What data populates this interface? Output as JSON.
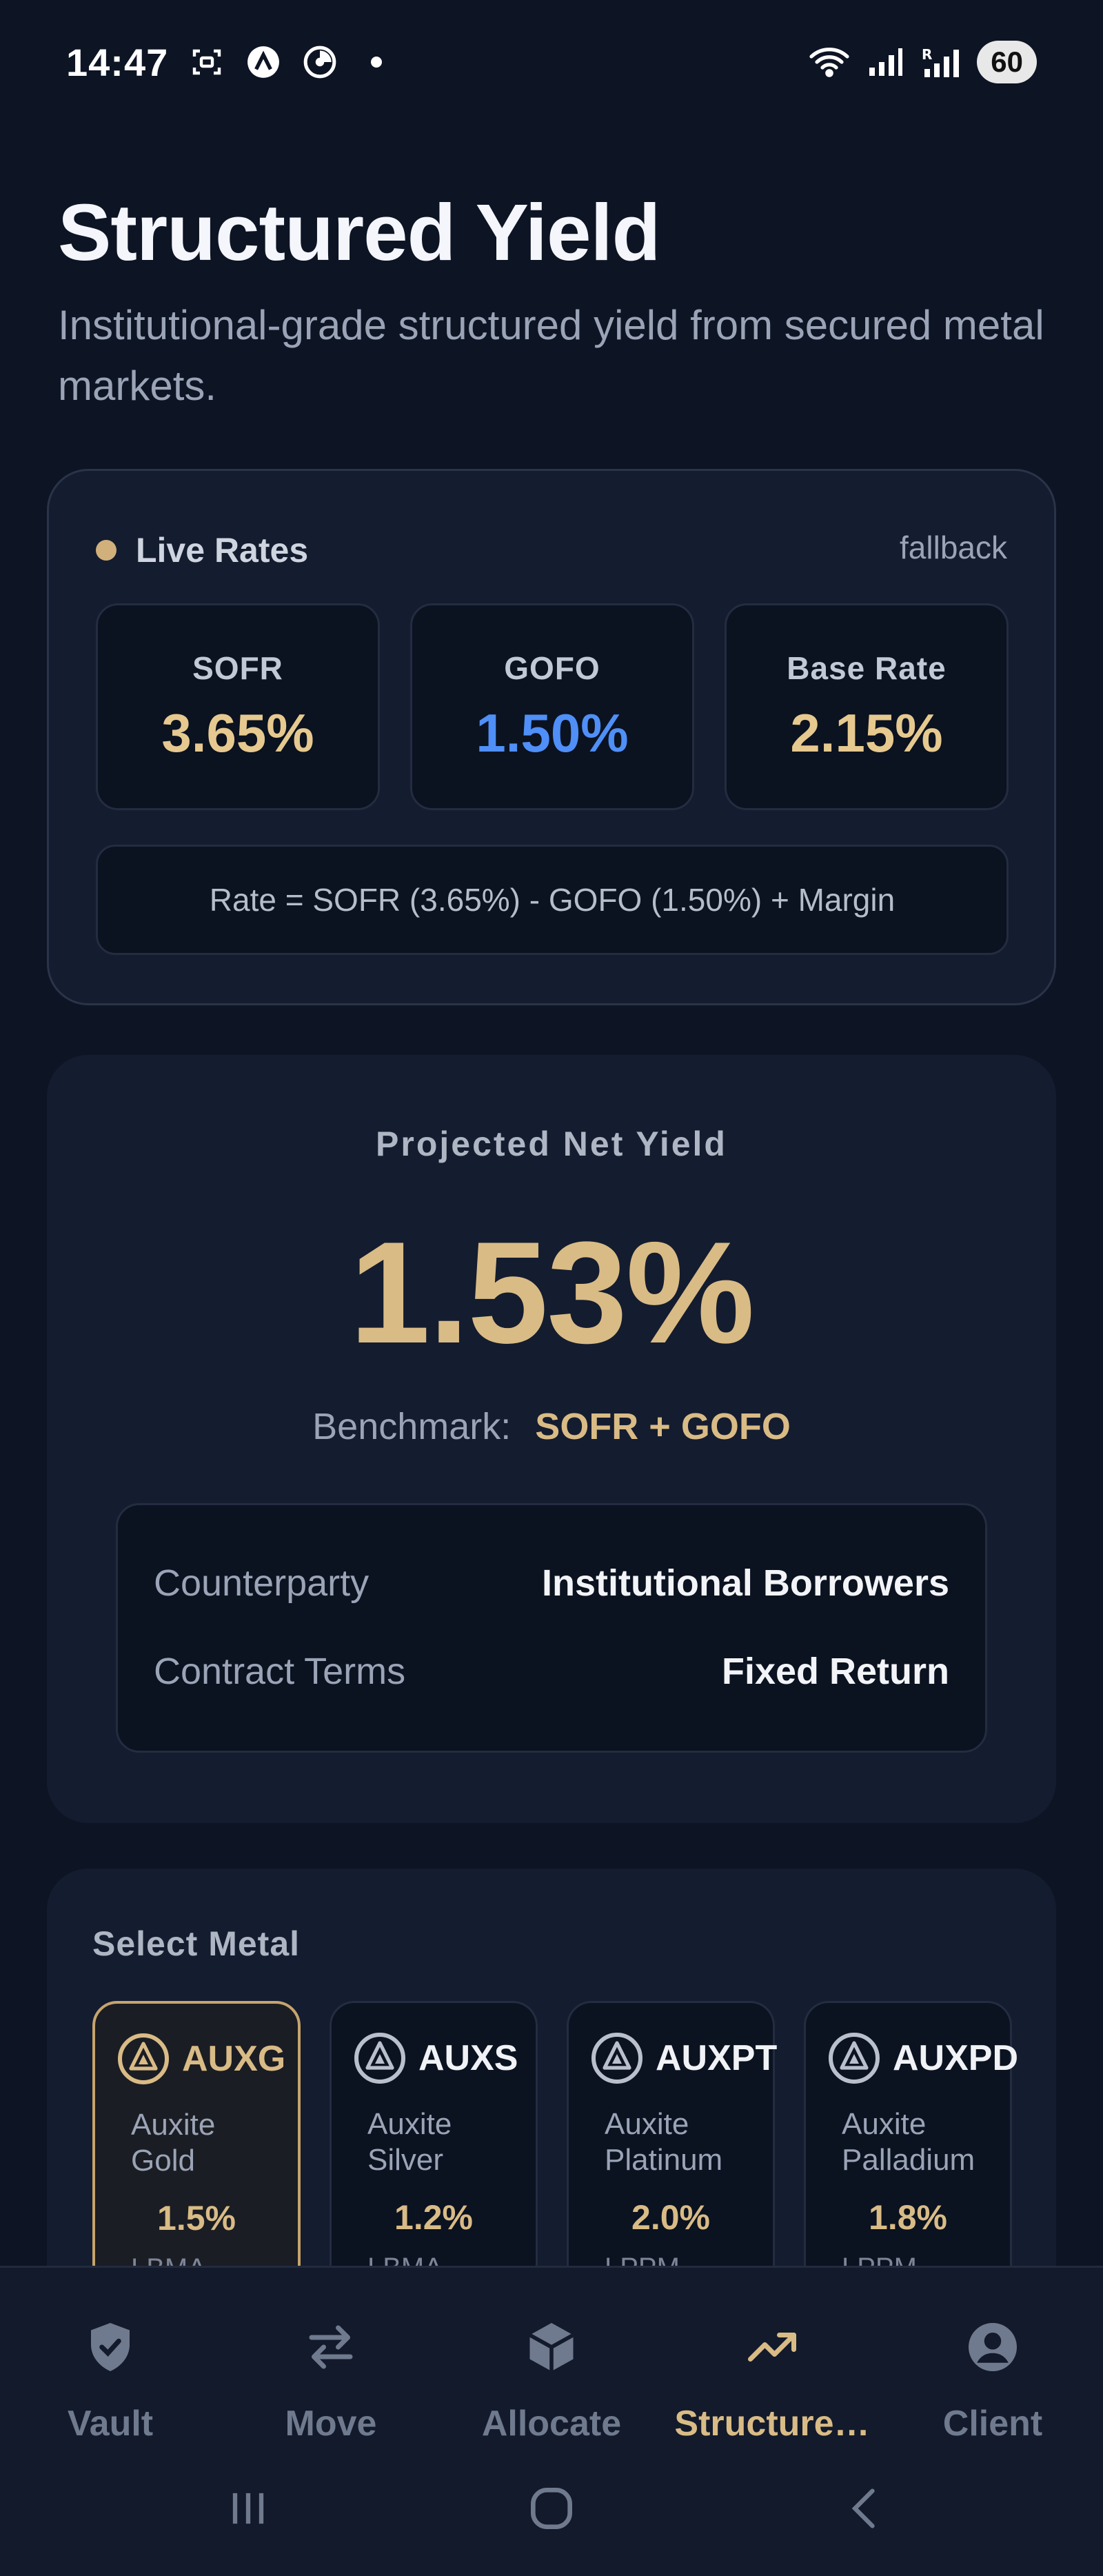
{
  "status_bar": {
    "time": "14:47",
    "battery": "60"
  },
  "header": {
    "title": "Structured Yield",
    "subtitle": "Institutional-grade structured yield from secured metal markets."
  },
  "live_rates": {
    "title": "Live Rates",
    "status": "fallback",
    "dot_color": "#d1b07c",
    "rates": [
      {
        "label": "SOFR",
        "value": "3.65%",
        "color": "#e6c98f"
      },
      {
        "label": "GOFO",
        "value": "1.50%",
        "color": "#4f8ff7"
      },
      {
        "label": "Base Rate",
        "value": "2.15%",
        "color": "#e6c98f"
      }
    ],
    "formula": "Rate = SOFR (3.65%) - GOFO (1.50%) + Margin"
  },
  "projected_yield": {
    "label": "Projected Net Yield",
    "value": "1.53%",
    "benchmark_label": "Benchmark:",
    "benchmark_value": "SOFR + GOFO",
    "details": [
      {
        "key": "Counterparty",
        "value": "Institutional Borrowers"
      },
      {
        "key": "Contract Terms",
        "value": "Fixed Return"
      }
    ]
  },
  "select_metal": {
    "title": "Select Metal",
    "metals": [
      {
        "symbol": "AUXG",
        "name": "Auxite Gold",
        "rate": "1.5%",
        "market": "LBMA",
        "selected": true
      },
      {
        "symbol": "AUXS",
        "name": "Auxite Silver",
        "rate": "1.2%",
        "market": "LBMA",
        "selected": false
      },
      {
        "symbol": "AUXPT",
        "name": "Auxite Platinum",
        "rate": "2.0%",
        "market": "LPPM",
        "selected": false
      },
      {
        "symbol": "AUXPD",
        "name": "Auxite Palladium",
        "rate": "1.8%",
        "market": "LPPM",
        "selected": false
      }
    ]
  },
  "bottom_nav": {
    "items": [
      {
        "label": "Vault",
        "icon": "shield-check-icon",
        "active": false
      },
      {
        "label": "Move",
        "icon": "swap-arrows-icon",
        "active": false
      },
      {
        "label": "Allocate",
        "icon": "cube-icon",
        "active": false
      },
      {
        "label": "Structure…",
        "icon": "trending-up-icon",
        "active": true
      },
      {
        "label": "Client",
        "icon": "user-circle-icon",
        "active": false
      }
    ]
  },
  "colors": {
    "gold": "#d9bb86",
    "blue": "#4f8ff7",
    "background": "#0d1424",
    "card": "#141c2f"
  }
}
